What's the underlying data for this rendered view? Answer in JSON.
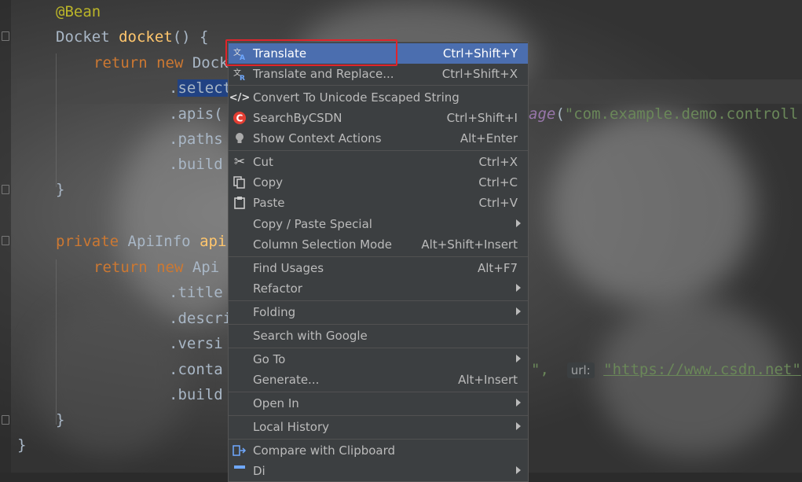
{
  "code": {
    "line1": "@Bean",
    "line2_type": "Docket",
    "line2_method": "docket",
    "line2_rest": "() {",
    "line3_kw": "return new",
    "line3_rest": "Dock",
    "line4_dot": ".",
    "line4_sel": "select",
    "line5": ".apis(",
    "line5_right_frag": "age",
    "line5_string": "\"com.example.demo.controll",
    "line6": ".paths",
    "line7": ".build",
    "line8": "}",
    "line10_kw": "private",
    "line10_type": "ApiInfo",
    "line10_method": "api",
    "line11_kw": "return new",
    "line11_rest": "Api",
    "line12": ".title",
    "line13": ".descri",
    "line14": ".versi",
    "line15": ".conta",
    "line15_right1": "\",",
    "line15_hint": "url:",
    "line15_string": "\"https://www.csdn.net\"",
    "line15_tail": ",",
    "line16": ".build",
    "line17": "}",
    "line18": "}"
  },
  "menu": {
    "items": [
      {
        "label": "Translate",
        "shortcut": "Ctrl+Shift+Y",
        "icon": "translate-icon"
      },
      {
        "label": "Translate and Replace...",
        "shortcut": "Ctrl+Shift+X",
        "icon": "translate-replace-icon"
      },
      {
        "label": "Convert To Unicode Escaped String",
        "shortcut": "",
        "icon": "code-icon"
      },
      {
        "label": "SearchByCSDN",
        "shortcut": "Ctrl+Shift+I",
        "icon": "csdn-icon"
      },
      {
        "label": "Show Context Actions",
        "shortcut": "Alt+Enter",
        "icon": "bulb-icon"
      },
      {
        "label": "Cut",
        "shortcut": "Ctrl+X",
        "icon": "scissors-icon"
      },
      {
        "label": "Copy",
        "shortcut": "Ctrl+C",
        "icon": "copy-icon"
      },
      {
        "label": "Paste",
        "shortcut": "Ctrl+V",
        "icon": "paste-icon"
      },
      {
        "label": "Copy / Paste Special",
        "shortcut": "",
        "icon": ""
      },
      {
        "label": "Column Selection Mode",
        "shortcut": "Alt+Shift+Insert",
        "icon": ""
      },
      {
        "label": "Find Usages",
        "shortcut": "Alt+F7",
        "icon": ""
      },
      {
        "label": "Refactor",
        "shortcut": "",
        "icon": ""
      },
      {
        "label": "Folding",
        "shortcut": "",
        "icon": ""
      },
      {
        "label": "Search with Google",
        "shortcut": "",
        "icon": ""
      },
      {
        "label": "Go To",
        "shortcut": "",
        "icon": ""
      },
      {
        "label": "Generate...",
        "shortcut": "Alt+Insert",
        "icon": ""
      },
      {
        "label": "Open In",
        "shortcut": "",
        "icon": ""
      },
      {
        "label": "Local History",
        "shortcut": "",
        "icon": ""
      },
      {
        "label": "Compare with Clipboard",
        "shortcut": "",
        "icon": "compare-icon"
      },
      {
        "label": "Di",
        "shortcut": "",
        "icon": "diagram-icon"
      }
    ]
  },
  "colors": {
    "highlight": "#4b6eaf",
    "annotation_box": "#e0242b"
  }
}
